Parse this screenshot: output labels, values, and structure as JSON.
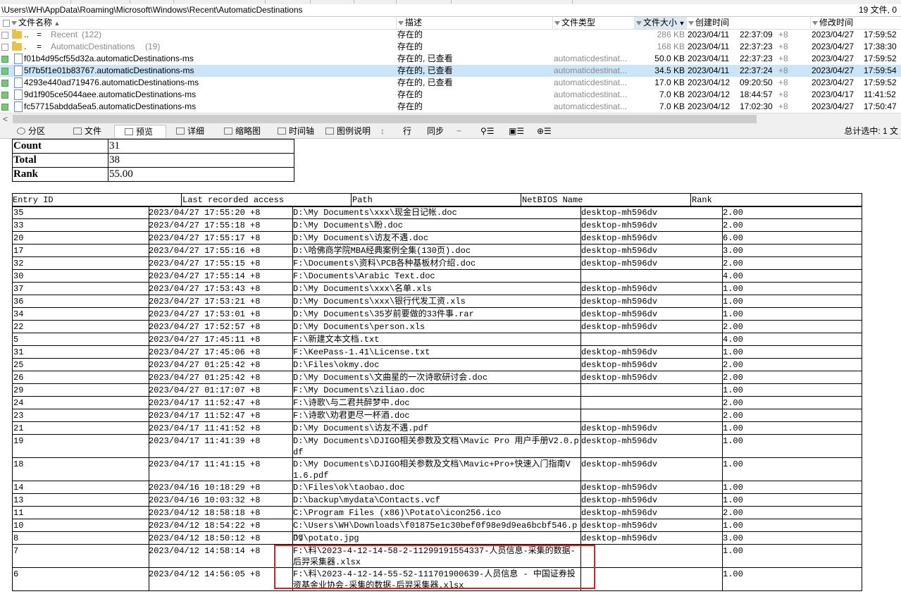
{
  "pathbar": {
    "path": "\\Users\\WH\\AppData\\Roaming\\Microsoft\\Windows\\Recent\\AutomaticDestinations",
    "count": "19 文件, 0"
  },
  "columns": {
    "name": "文件名称",
    "desc": "描述",
    "type": "文件类型",
    "size": "文件大小",
    "created": "创建时间",
    "modified": "修改时间"
  },
  "files": [
    {
      "name": "..",
      "eq": "=",
      "target": "Recent",
      "extra": "(122)",
      "desc": "存在的",
      "type": "",
      "size": "286 KB",
      "cdate": "2023/04/11",
      "ctime": "22:37:09",
      "ctz": "+8",
      "mdate": "2023/04/27",
      "mtime": "17:59:52"
    },
    {
      "name": ".",
      "eq": "=",
      "target": "AutomaticDestinations",
      "extra": "(19)",
      "desc": "存在的",
      "type": "",
      "size": "168 KB",
      "cdate": "2023/04/11",
      "ctime": "22:37:23",
      "ctz": "+8",
      "mdate": "2023/04/27",
      "mtime": "17:38:30"
    },
    {
      "name": "f01b4d95cf55d32a.automaticDestinations-ms",
      "desc": "存在的, 已查看",
      "type": "automaticdestinat...",
      "size": "50.0 KB",
      "cdate": "2023/04/11",
      "ctime": "22:37:23",
      "ctz": "+8",
      "mdate": "2023/04/27",
      "mtime": "17:59:52"
    },
    {
      "name": "5f7b5f1e01b83767.automaticDestinations-ms",
      "desc": "存在的, 已查看",
      "type": "automaticdestinat...",
      "size": "34.5 KB",
      "cdate": "2023/04/11",
      "ctime": "22:37:24",
      "ctz": "+8",
      "mdate": "2023/04/27",
      "mtime": "17:59:54"
    },
    {
      "name": "4293e440ad719476.automaticDestinations-ms",
      "desc": "存在的, 已查看",
      "type": "automaticdestinat...",
      "size": "17.0 KB",
      "cdate": "2023/04/12",
      "ctime": "09:20:50",
      "ctz": "+8",
      "mdate": "2023/04/27",
      "mtime": "17:59:52"
    },
    {
      "name": "9d1f905ce5044aee.automaticDestinations-ms",
      "desc": "存在的",
      "type": "automaticdestinat...",
      "size": "7.0 KB",
      "cdate": "2023/04/12",
      "ctime": "18:44:57",
      "ctz": "+8",
      "mdate": "2023/04/17",
      "mtime": "11:41:52"
    },
    {
      "name": "fc57715abdda5ea5.automaticDestinations-ms",
      "desc": "存在的",
      "type": "automaticdestinat...",
      "size": "7.0 KB",
      "cdate": "2023/04/12",
      "ctime": "17:02:30",
      "ctz": "+8",
      "mdate": "2023/04/27",
      "mtime": "17:50:47"
    }
  ],
  "tabs": [
    "分区",
    "文件",
    "预览",
    "详细",
    "缩略图",
    "时间轴",
    "图例说明",
    "行",
    "同步"
  ],
  "tabs_summary": "总计选中: 1 文",
  "summary": [
    {
      "k": "Count",
      "v": "31"
    },
    {
      "k": "Total",
      "v": "38"
    },
    {
      "k": "Rank",
      "v": "55.00"
    }
  ],
  "report_headers": [
    "Entry ID",
    "Last recorded access",
    "Path",
    "NetBIOS Name",
    "Rank"
  ],
  "entries": [
    [
      "35",
      "2023/04/27 17:55:20 +8",
      "D:\\My Documents\\xxx\\现金日记帐.doc",
      "desktop-mh596dv",
      "2.00"
    ],
    [
      "33",
      "2023/04/27 17:55:18 +8",
      "D:\\My Documents\\盼.doc",
      "desktop-mh596dv",
      "2.00"
    ],
    [
      "20",
      "2023/04/27 17:55:17 +8",
      "D:\\My Documents\\访友不遇.doc",
      "desktop-mh596dv",
      "6.00"
    ],
    [
      "17",
      "2023/04/27 17:55:16 +8",
      "D:\\哈佛商学院MBA经典案例全集(130页).doc",
      "desktop-mh596dv",
      "3.00"
    ],
    [
      "32",
      "2023/04/27 17:55:15 +8",
      "F:\\Documents\\资料\\PCB各种基板材介绍.doc",
      "desktop-mh596dv",
      "2.00"
    ],
    [
      "30",
      "2023/04/27 17:55:14 +8",
      "F:\\Documents\\Arabic Text.doc",
      "",
      "4.00"
    ],
    [
      "37",
      "2023/04/27 17:53:43 +8",
      "D:\\My Documents\\xxx\\名单.xls",
      "desktop-mh596dv",
      "1.00"
    ],
    [
      "36",
      "2023/04/27 17:53:21 +8",
      "D:\\My Documents\\xxx\\银行代发工资.xls",
      "desktop-mh596dv",
      "1.00"
    ],
    [
      "34",
      "2023/04/27 17:53:01 +8",
      "D:\\My Documents\\35岁前要做的33件事.rar",
      "desktop-mh596dv",
      "1.00"
    ],
    [
      "22",
      "2023/04/27 17:52:57 +8",
      "D:\\My Documents\\person.xls",
      "desktop-mh596dv",
      "2.00"
    ],
    [
      "5",
      "2023/04/27 17:45:11 +8",
      "F:\\新建文本文档.txt",
      "",
      "4.00"
    ],
    [
      "31",
      "2023/04/27 17:45:06 +8",
      "F:\\KeePass-1.41\\License.txt",
      "desktop-mh596dv",
      "1.00"
    ],
    [
      "25",
      "2023/04/27 01:25:42 +8",
      "D:\\Files\\okmy.doc",
      "desktop-mh596dv",
      "2.00"
    ],
    [
      "26",
      "2023/04/27 01:25:42 +8",
      "D:\\My Documents\\文曲星的一次诗歌研讨会.doc",
      "desktop-mh596dv",
      "2.00"
    ],
    [
      "29",
      "2023/04/27 01:17:07 +8",
      "F:\\My Documents\\ziliao.doc",
      "",
      "1.00"
    ],
    [
      "24",
      "2023/04/17 11:52:47 +8",
      "F:\\诗歌\\与二君共醉梦中.doc",
      "",
      "2.00"
    ],
    [
      "23",
      "2023/04/17 11:52:47 +8",
      "F:\\诗歌\\劝君更尽一杯酒.doc",
      "",
      "2.00"
    ],
    [
      "21",
      "2023/04/17 11:41:52 +8",
      "D:\\My Documents\\访友不遇.pdf",
      "desktop-mh596dv",
      "1.00"
    ],
    [
      "19",
      "2023/04/17 11:41:39 +8",
      "D:\\My Documents\\DJIGO相关参数及文档\\Mavic Pro 用户手册V2.0.pdf",
      "desktop-mh596dv",
      "1.00"
    ],
    [
      "18",
      "2023/04/17 11:41:15 +8",
      "D:\\My Documents\\DJIGO相关参数及文档\\Mavic+Pro+快速入门指南V1.6.pdf",
      "desktop-mh596dv",
      "1.00"
    ],
    [
      "14",
      "2023/04/16 10:18:29 +8",
      "D:\\Files\\ok\\taobao.doc",
      "desktop-mh596dv",
      "1.00"
    ],
    [
      "13",
      "2023/04/16 10:03:32 +8",
      "D:\\backup\\mydata\\Contacts.vcf",
      "desktop-mh596dv",
      "1.00"
    ],
    [
      "11",
      "2023/04/12 18:58:18 +8",
      "C:\\Program Files (x86)\\Potato\\icon256.ico",
      "desktop-mh596dv",
      "2.00"
    ],
    [
      "10",
      "2023/04/12 18:54:22 +8",
      "C:\\Users\\WH\\Downloads\\f01875e1c30bef0f98e9d9ea6bcbf546.png",
      "desktop-mh596dv",
      "1.00"
    ],
    [
      "8",
      "2023/04/12 18:50:12 +8",
      "D:\\potato.jpg",
      "desktop-mh596dv",
      "3.00"
    ],
    [
      "7",
      "2023/04/12 14:58:14 +8",
      "F:\\料\\2023-4-12-14-58-2-11299191554337-人员信息-采集的数据-后羿采集器.xlsx",
      "",
      "1.00"
    ],
    [
      "6",
      "2023/04/12 14:56:05 +8",
      "F:\\料\\2023-4-12-14-55-52-111701900639-人员信息 - 中国证券投资基金业协会-采集的数据-后羿采集器.xlsx",
      "",
      "1.00"
    ]
  ]
}
